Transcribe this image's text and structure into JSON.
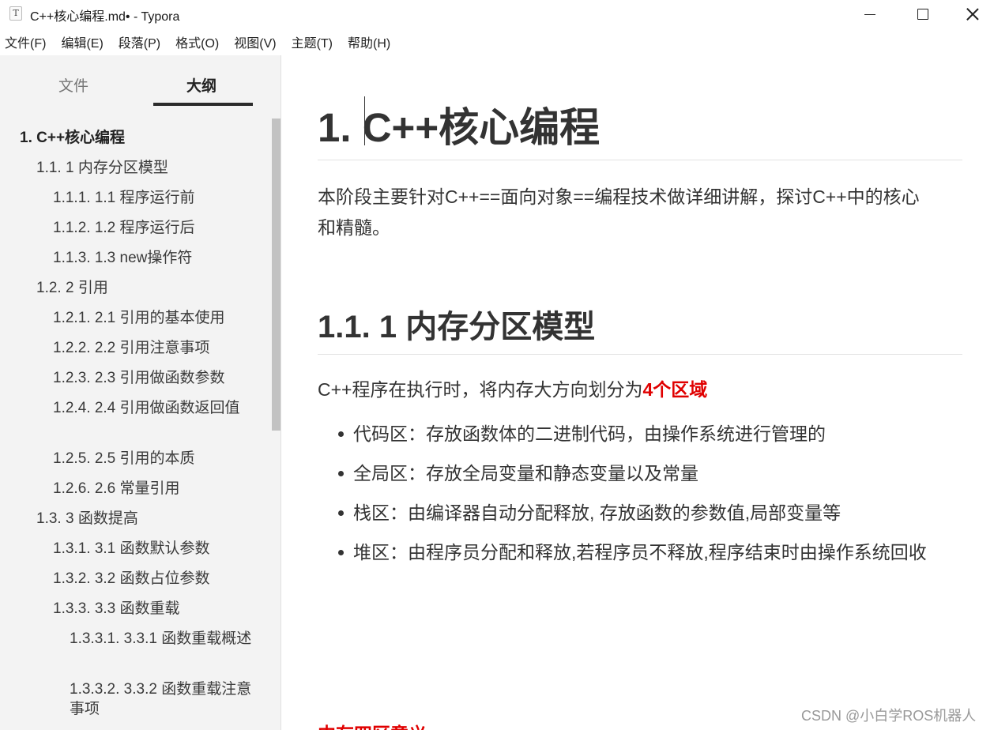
{
  "window": {
    "title": "C++核心编程.md• - Typora",
    "app_icon": "T",
    "controls": [
      "minimize-icon",
      "maximize-icon",
      "close-icon"
    ]
  },
  "menu": [
    "文件(F)",
    "编辑(E)",
    "段落(P)",
    "格式(O)",
    "视图(V)",
    "主题(T)",
    "帮助(H)"
  ],
  "sidebar": {
    "tabs": [
      {
        "label": "文件",
        "active": false
      },
      {
        "label": "大纲",
        "active": true
      }
    ],
    "outline": [
      {
        "label": "1. C++核心编程",
        "level": 1
      },
      {
        "label": "1.1. 1 内存分区模型",
        "level": 2
      },
      {
        "label": "1.1.1. 1.1 程序运行前",
        "level": 3
      },
      {
        "label": "1.1.2. 1.2 程序运行后",
        "level": 3
      },
      {
        "label": "1.1.3. 1.3 new操作符",
        "level": 3
      },
      {
        "label": "1.2. 2 引用",
        "level": 2
      },
      {
        "label": "1.2.1. 2.1 引用的基本使用",
        "level": 3
      },
      {
        "label": "1.2.2. 2.2 引用注意事项",
        "level": 3
      },
      {
        "label": "1.2.3. 2.3 引用做函数参数",
        "level": 3
      },
      {
        "label": "1.2.4. 2.4 引用做函数返回值",
        "level": 3
      },
      {
        "label": "1.2.5. 2.5 引用的本质",
        "level": 3
      },
      {
        "label": "1.2.6. 2.6 常量引用",
        "level": 3
      },
      {
        "label": "1.3. 3 函数提高",
        "level": 2
      },
      {
        "label": "1.3.1. 3.1 函数默认参数",
        "level": 3
      },
      {
        "label": "1.3.2. 3.2 函数占位参数",
        "level": 3
      },
      {
        "label": "1.3.3. 3.3 函数重载",
        "level": 3
      },
      {
        "label": "1.3.3.1. 3.3.1 函数重载概述",
        "level": 4
      },
      {
        "label": "1.3.3.2. 3.3.2 函数重载注意事项",
        "level": 4
      }
    ]
  },
  "editor": {
    "h1": "1. C++核心编程",
    "intro_line1": "本阶段主要针对C++==面向对象==编程技术做详细讲解，探讨C++中的核心",
    "intro_line2": "和精髓。",
    "h2": "1.1. 1 内存分区模型",
    "para_prefix": "C++程序在执行时，将内存大方向划分为",
    "para_highlight": "4个区域",
    "bullets": [
      "代码区：存放函数体的二进制代码，由操作系统进行管理的",
      "全局区：存放全局变量和静态变量以及常量",
      "栈区：由编译器自动分配释放, 存放函数的参数值,局部变量等",
      "堆区：由程序员分配和释放,若程序员不释放,程序结束时由操作系统回收"
    ],
    "cut_heading": "内存四区意义",
    "accent_color": "#e00000"
  },
  "watermark": "CSDN @小白学ROS机器人"
}
